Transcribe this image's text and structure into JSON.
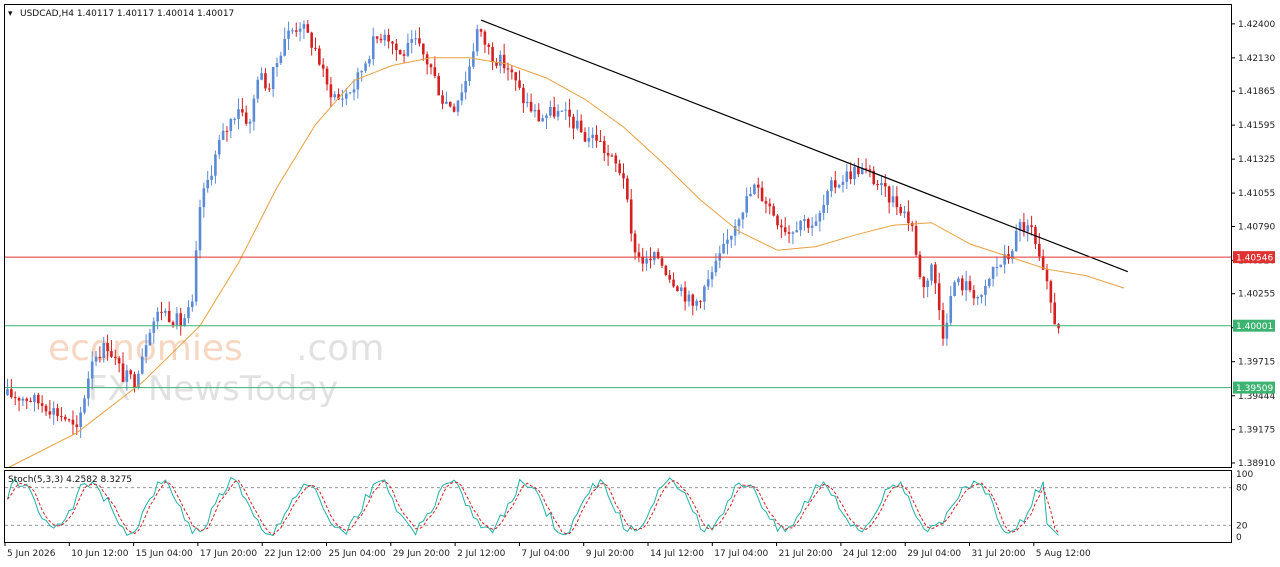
{
  "header": {
    "symbol_line": "USDCAD,H4  1.40117 1.40117 1.40014 1.40017"
  },
  "watermark": {
    "brand_main": "economies",
    "brand_suffix": ".com",
    "sub_prefix": "FX",
    "sub_main": "NewsToday"
  },
  "colors": {
    "bull": "#5b8bd6",
    "bear": "#d42020",
    "ma": "#e8a040",
    "trendline": "#000000",
    "resistance": "#e03030",
    "support": "#3cb371",
    "stoch_main": "#20b2aa",
    "stoch_signal": "#d42020"
  },
  "chart_data": [
    {
      "type": "candlestick",
      "symbol": "USDCAD",
      "timeframe": "H4",
      "ylim": [
        1.3887,
        1.4255
      ],
      "price_ticks": [
        "1.42400",
        "1.42130",
        "1.41865",
        "1.41595",
        "1.41325",
        "1.41055",
        "1.40790",
        "1.40520",
        "1.40255",
        "1.39985",
        "1.39715",
        "1.39444",
        "1.39175",
        "1.38910"
      ],
      "x_labels": [
        "5 Jun 2026",
        "10 Jun 12:00",
        "15 Jun 04:00",
        "17 Jun 20:00",
        "22 Jun 12:00",
        "25 Jun 04:00",
        "29 Jun 20:00",
        "2 Jul 12:00",
        "7 Jul 04:00",
        "9 Jul 20:00",
        "14 Jul 12:00",
        "17 Jul 04:00",
        "21 Jul 20:00",
        "24 Jul 12:00",
        "29 Jul 04:00",
        "31 Jul 20:00",
        "5 Aug 12:00"
      ],
      "levels": [
        {
          "label": "1.40546",
          "value": 1.40546,
          "role": "resistance"
        },
        {
          "label": "1.40001",
          "value": 1.40001,
          "role": "support"
        },
        {
          "label": "1.39509",
          "value": 1.39509,
          "role": "support"
        }
      ],
      "trendline": {
        "from": {
          "bar": 123,
          "price": 1.4243
        },
        "to": {
          "bar": 291,
          "price": 1.4043
        }
      },
      "moving_average_anchors": [
        [
          0,
          1.3887
        ],
        [
          18,
          1.3915
        ],
        [
          35,
          1.3955
        ],
        [
          50,
          1.4
        ],
        [
          60,
          1.405
        ],
        [
          70,
          1.411
        ],
        [
          80,
          1.416
        ],
        [
          90,
          1.4195
        ],
        [
          100,
          1.4207
        ],
        [
          110,
          1.4213
        ],
        [
          120,
          1.4213
        ],
        [
          130,
          1.4208
        ],
        [
          140,
          1.4197
        ],
        [
          150,
          1.418
        ],
        [
          160,
          1.4158
        ],
        [
          170,
          1.413
        ],
        [
          180,
          1.41
        ],
        [
          190,
          1.4075
        ],
        [
          200,
          1.406
        ],
        [
          210,
          1.4063
        ],
        [
          220,
          1.4072
        ],
        [
          230,
          1.408
        ],
        [
          240,
          1.4082
        ],
        [
          250,
          1.4065
        ],
        [
          260,
          1.4055
        ],
        [
          270,
          1.4045
        ],
        [
          280,
          1.404
        ],
        [
          290,
          1.403
        ]
      ],
      "close_anchors": [
        [
          0,
          1.3945
        ],
        [
          5,
          1.3943
        ],
        [
          10,
          1.3937
        ],
        [
          15,
          1.3927
        ],
        [
          18,
          1.3915
        ],
        [
          22,
          1.3975
        ],
        [
          26,
          1.3985
        ],
        [
          30,
          1.396
        ],
        [
          33,
          1.3957
        ],
        [
          37,
          1.4
        ],
        [
          40,
          1.4013
        ],
        [
          45,
          1.4002
        ],
        [
          48,
          1.4015
        ],
        [
          50,
          1.4095
        ],
        [
          52,
          1.4115
        ],
        [
          55,
          1.4145
        ],
        [
          60,
          1.4175
        ],
        [
          63,
          1.416
        ],
        [
          65,
          1.42
        ],
        [
          68,
          1.419
        ],
        [
          72,
          1.423
        ],
        [
          76,
          1.424
        ],
        [
          80,
          1.422
        ],
        [
          83,
          1.419
        ],
        [
          86,
          1.418
        ],
        [
          90,
          1.419
        ],
        [
          95,
          1.4225
        ],
        [
          98,
          1.4235
        ],
        [
          102,
          1.4215
        ],
        [
          106,
          1.4225
        ],
        [
          110,
          1.4205
        ],
        [
          113,
          1.418
        ],
        [
          116,
          1.4175
        ],
        [
          119,
          1.4195
        ],
        [
          122,
          1.4235
        ],
        [
          126,
          1.4215
        ],
        [
          130,
          1.4205
        ],
        [
          134,
          1.418
        ],
        [
          138,
          1.4165
        ],
        [
          142,
          1.417
        ],
        [
          146,
          1.4165
        ],
        [
          150,
          1.415
        ],
        [
          153,
          1.415
        ],
        [
          156,
          1.4135
        ],
        [
          160,
          1.412
        ],
        [
          162,
          1.407
        ],
        [
          164,
          1.4055
        ],
        [
          166,
          1.405
        ],
        [
          169,
          1.4055
        ],
        [
          172,
          1.404
        ],
        [
          175,
          1.403
        ],
        [
          178,
          1.4015
        ],
        [
          182,
          1.4035
        ],
        [
          186,
          1.406
        ],
        [
          190,
          1.409
        ],
        [
          194,
          1.411
        ],
        [
          197,
          1.41
        ],
        [
          200,
          1.4085
        ],
        [
          203,
          1.4075
        ],
        [
          206,
          1.4085
        ],
        [
          210,
          1.408
        ],
        [
          214,
          1.411
        ],
        [
          218,
          1.412
        ],
        [
          221,
          1.4125
        ],
        [
          224,
          1.412
        ],
        [
          228,
          1.4105
        ],
        [
          232,
          1.4095
        ],
        [
          235,
          1.408
        ],
        [
          236,
          1.4055
        ],
        [
          238,
          1.403
        ],
        [
          240,
          1.405
        ],
        [
          243,
          1.3995
        ],
        [
          246,
          1.4035
        ],
        [
          250,
          1.403
        ],
        [
          253,
          1.402
        ],
        [
          256,
          1.4045
        ],
        [
          260,
          1.4055
        ],
        [
          263,
          1.408
        ],
        [
          266,
          1.4075
        ],
        [
          268,
          1.405
        ],
        [
          270,
          1.403
        ],
        [
          272,
          1.4005
        ],
        [
          273,
          1.4002
        ]
      ],
      "stochastic": {
        "label": "Stoch(5,3,3) 4.2582 8.3275",
        "k": 4.2582,
        "d": 8.3275,
        "ylim": [
          0,
          100
        ],
        "ticks": [
          "100",
          "80",
          "20",
          "0"
        ],
        "levels": [
          80,
          20
        ]
      }
    }
  ]
}
